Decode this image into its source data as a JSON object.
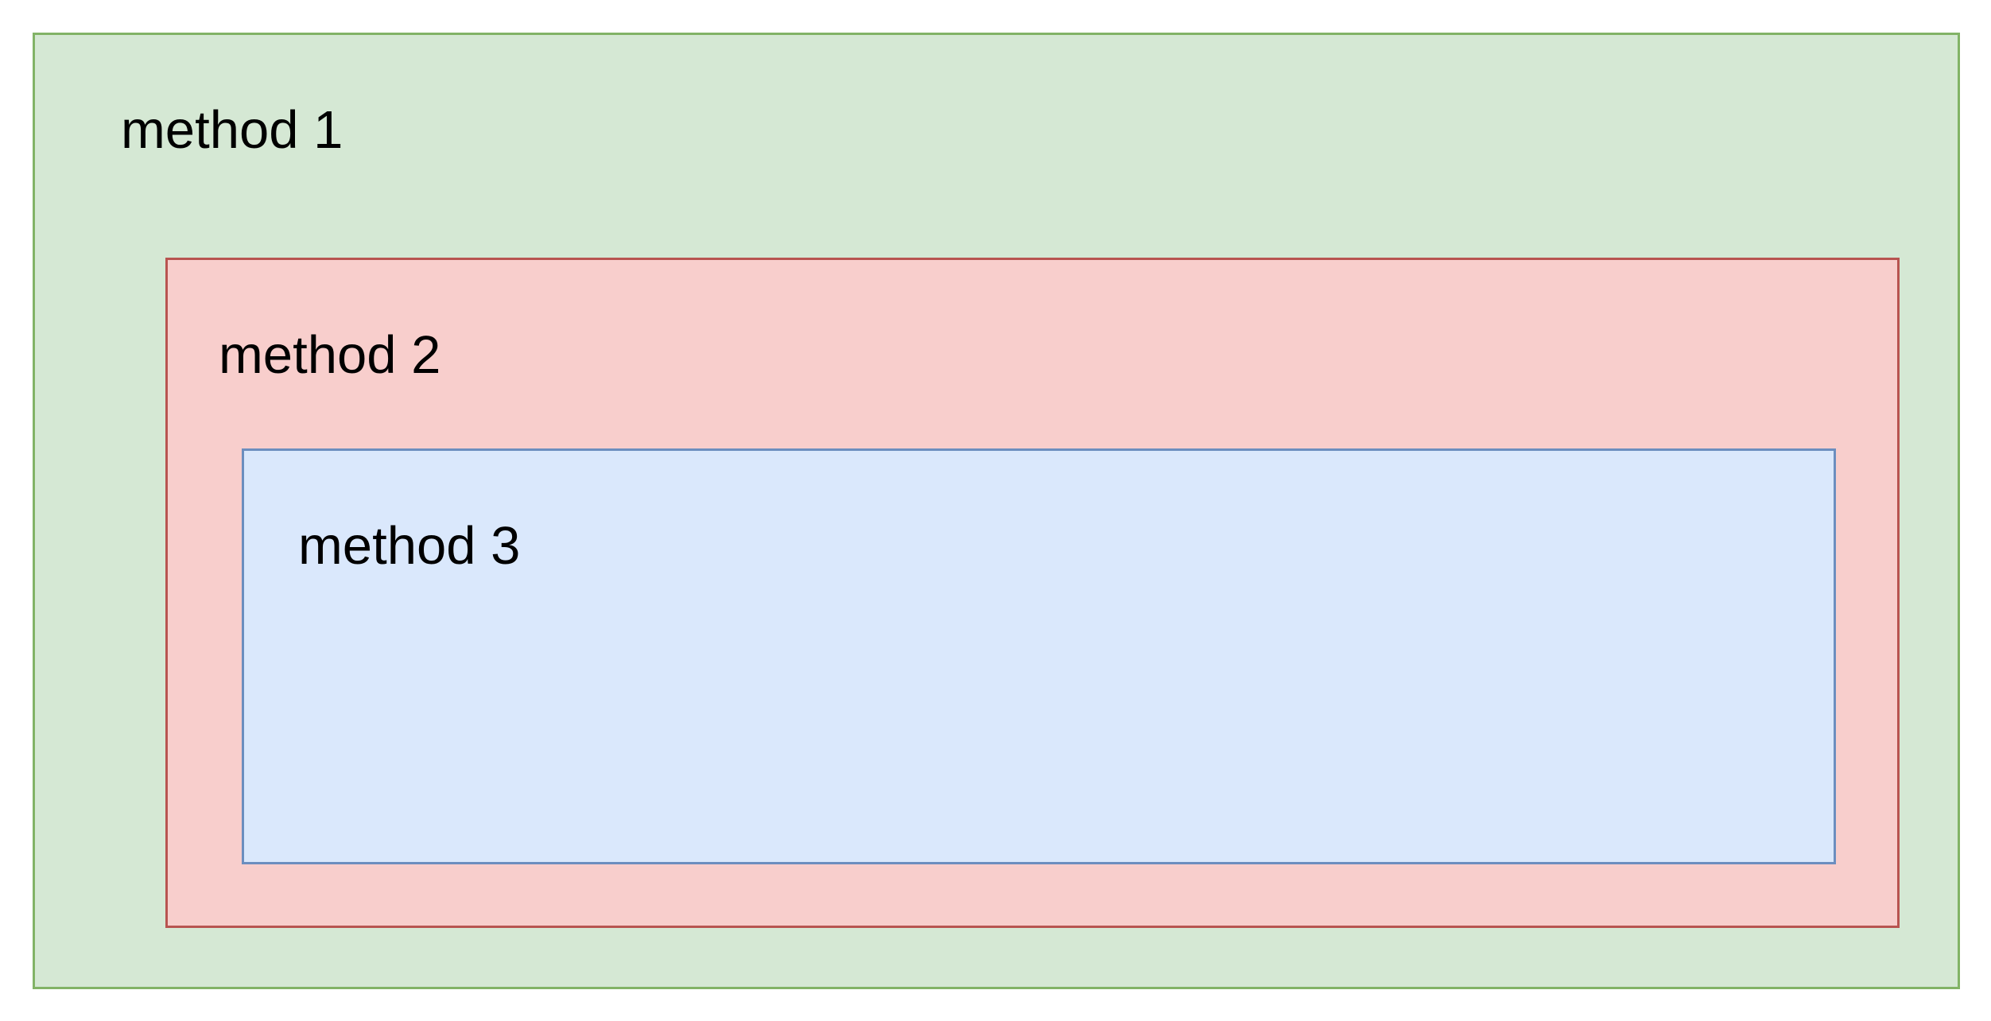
{
  "diagram": {
    "boxes": [
      {
        "label": "method 1",
        "fill": "#d5e8d4",
        "stroke": "#82b366"
      },
      {
        "label": "method 2",
        "fill": "#f8cecc",
        "stroke": "#b85450"
      },
      {
        "label": "method 3",
        "fill": "#dae8fc",
        "stroke": "#6c8ebf"
      }
    ]
  }
}
